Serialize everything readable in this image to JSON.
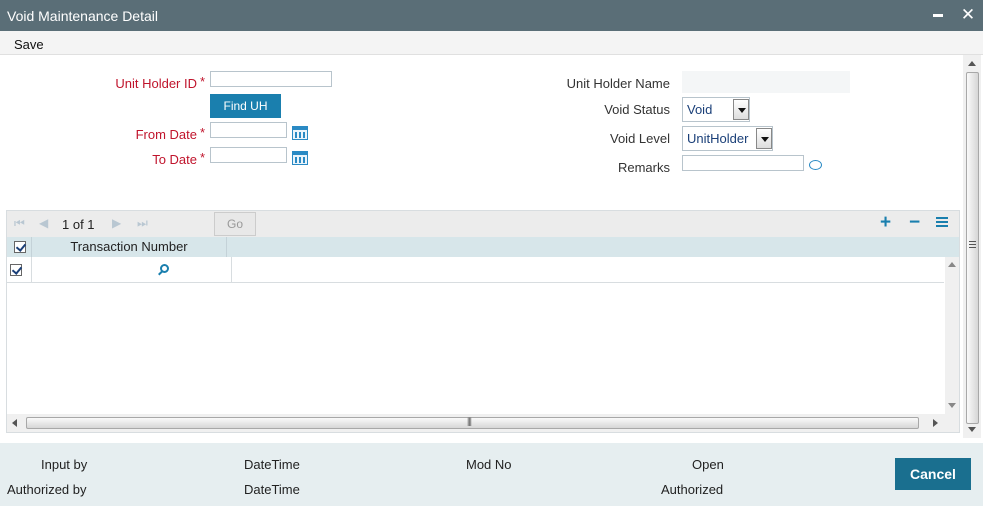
{
  "window": {
    "title": "Void Maintenance Detail"
  },
  "menu": {
    "save": "Save"
  },
  "form": {
    "unit_holder_id": {
      "label": "Unit Holder ID",
      "value": ""
    },
    "find_uh": "Find UH",
    "from_date": {
      "label": "From Date",
      "value": ""
    },
    "to_date": {
      "label": "To Date",
      "value": ""
    },
    "unit_holder_name": {
      "label": "Unit Holder Name",
      "value": ""
    },
    "void_status": {
      "label": "Void Status",
      "value": "Void"
    },
    "void_level": {
      "label": "Void Level",
      "value": "UnitHolder"
    },
    "remarks": {
      "label": "Remarks",
      "value": ""
    },
    "required_mark": "*"
  },
  "grid": {
    "pager": "1 of 1",
    "go": "Go",
    "columns": [
      "Transaction Number"
    ],
    "rows": [
      {
        "transaction_number": ""
      }
    ],
    "icons": [
      "first-page-icon",
      "prev-page-icon",
      "next-page-icon",
      "last-page-icon",
      "add-row-icon",
      "delete-row-icon",
      "single-view-icon"
    ]
  },
  "footer": {
    "input_by": "Input by",
    "datetime_1": "DateTime",
    "mod_no": "Mod No",
    "open": "Open",
    "authorized_by": "Authorized by",
    "datetime_2": "DateTime",
    "authorized": "Authorized",
    "cancel": "Cancel"
  },
  "colors": {
    "titlebar": "#5a6e77",
    "accent": "#1a7fae",
    "required": "#c0142c",
    "grid_header": "#d7e6ea",
    "footer": "#e6eef0"
  }
}
